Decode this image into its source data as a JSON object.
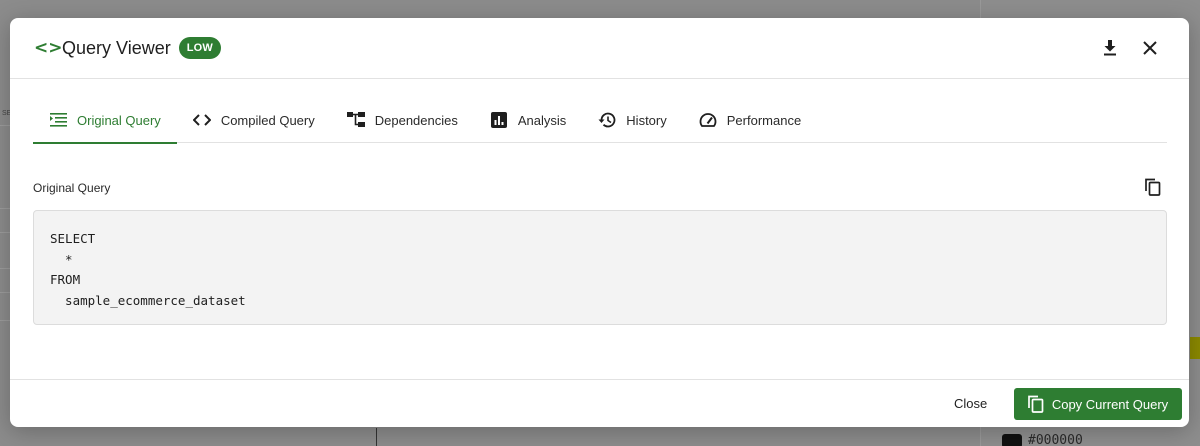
{
  "background": {
    "hex_text": "#000000"
  },
  "modal": {
    "title": "Query Viewer",
    "badge": "LOW",
    "accent_color": "#2e7d32",
    "tabs": [
      {
        "label": "Original Query",
        "icon": "indent-list-icon",
        "active": true
      },
      {
        "label": "Compiled Query",
        "icon": "code-icon",
        "active": false
      },
      {
        "label": "Dependencies",
        "icon": "tree-icon",
        "active": false
      },
      {
        "label": "Analysis",
        "icon": "chart-icon",
        "active": false
      },
      {
        "label": "History",
        "icon": "history-icon",
        "active": false
      },
      {
        "label": "Performance",
        "icon": "speed-icon",
        "active": false
      }
    ],
    "section_title": "Original Query",
    "query": "SELECT\n  *\nFROM\n  sample_ecommerce_dataset",
    "footer": {
      "close_label": "Close",
      "copy_label": "Copy Current Query"
    }
  }
}
